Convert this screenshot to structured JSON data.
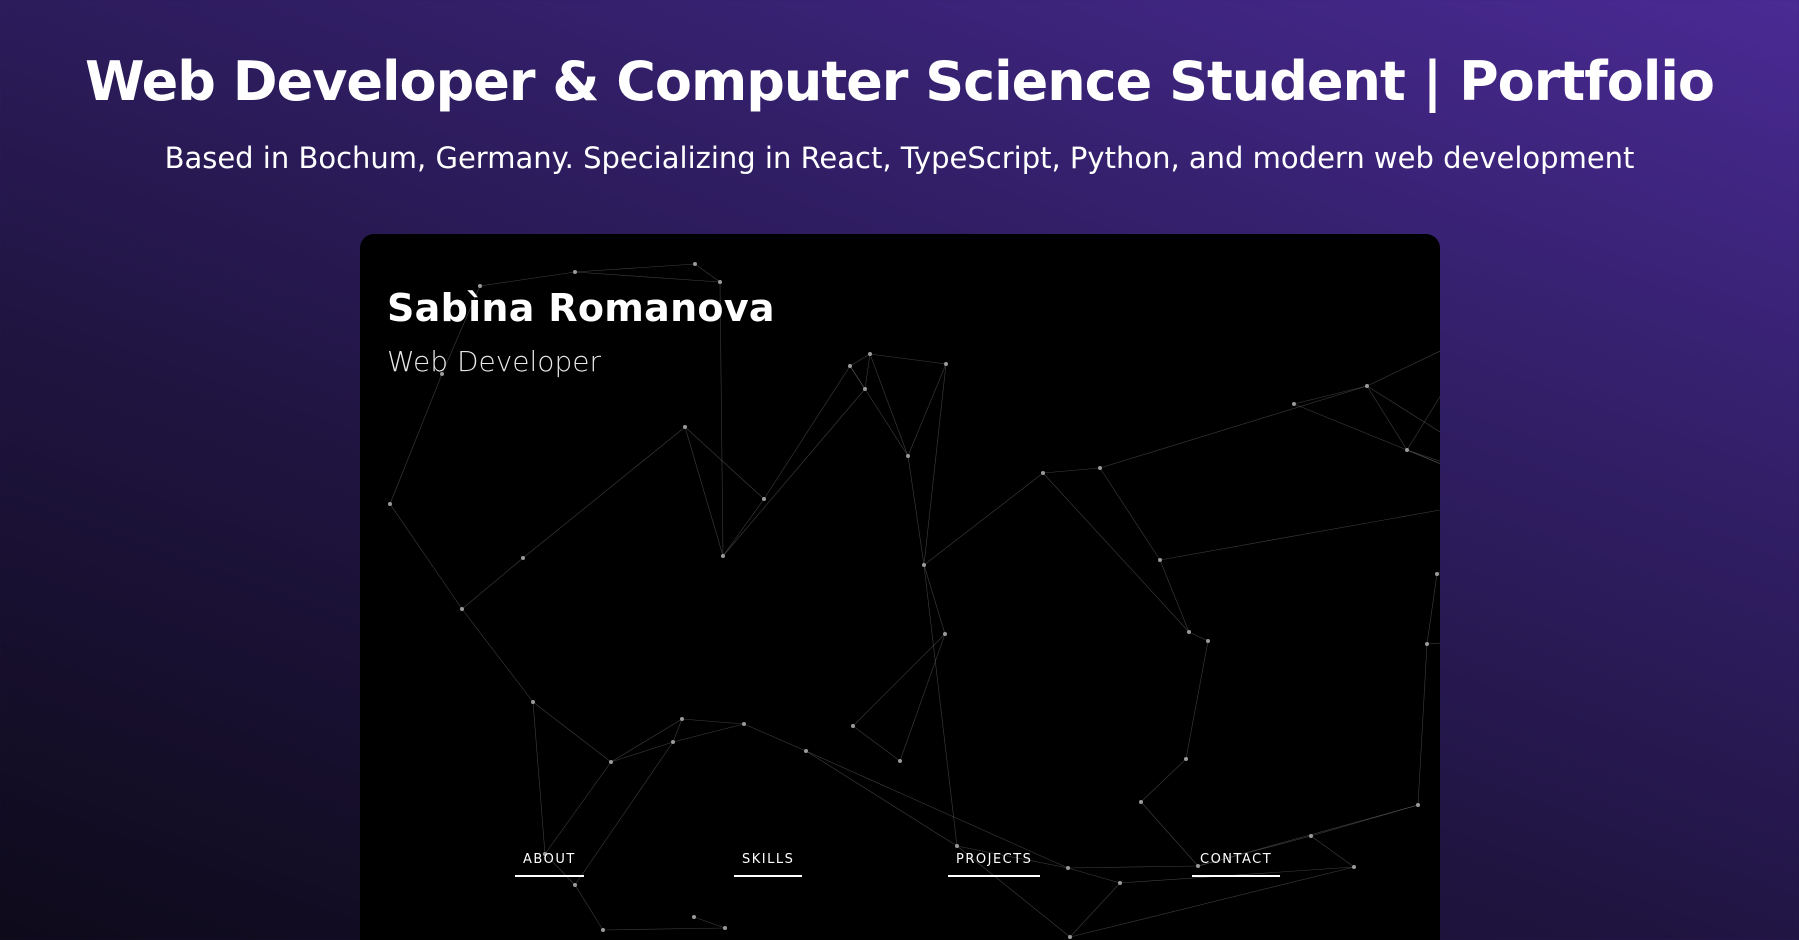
{
  "header": {
    "title": "Web Developer & Computer Science Student | Portfolio",
    "subtitle": "Based in Bochum, Germany. Specializing in React, TypeScript, Python, and modern web development"
  },
  "card": {
    "name": "Sabìna Romanova",
    "role": "Web Developer",
    "nav": [
      "ABOUT",
      "SKILLS",
      "PROJECTS",
      "CONTACT"
    ]
  },
  "colors": {
    "background_top": "#4a2a94",
    "background_bottom": "#0e0a1a",
    "card": "#000000",
    "text": "#ffffff"
  }
}
